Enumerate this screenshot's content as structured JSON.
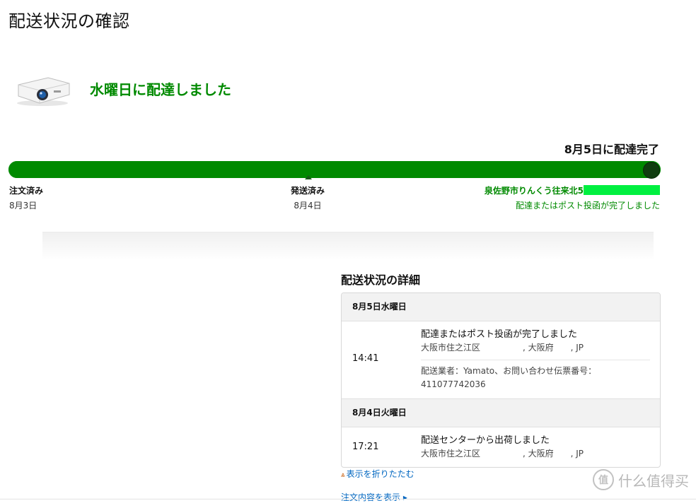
{
  "page": {
    "title": "配送状況の確認"
  },
  "delivery": {
    "headline": "水曜日に配達しました",
    "eta_label": "8月5日に配達完了",
    "progress_fraction": 1.0
  },
  "milestones": [
    {
      "label": "注文済み",
      "date": "8月3日"
    },
    {
      "label": "発送済み",
      "date": "8月4日"
    },
    {
      "label": "泉佐野市りんくう往来北5",
      "date": "配達またはポスト投函が完了しました"
    }
  ],
  "details": {
    "title": "配送状況の詳細",
    "days": [
      {
        "header": "8月5日水曜日",
        "events": [
          {
            "time": "14:41",
            "status": "配達またはポスト投函が完了しました",
            "location": "大阪市住之江区　　　　　, 大阪府　　, JP",
            "carrier": "配送業者：Yamato、お問い合わせ伝票番号：411077742036"
          }
        ]
      },
      {
        "header": "8月4日火曜日",
        "events": [
          {
            "time": "17:21",
            "status": "配送センターから出荷しました",
            "location": "大阪市住之江区　　　　　, 大阪府　　, JP"
          }
        ]
      }
    ]
  },
  "links": {
    "collapse": "表示を折りたたむ",
    "order_details": "注文内容を表示"
  },
  "watermark": {
    "badge": "值",
    "text": "什么值得买"
  },
  "colors": {
    "success_green": "#008a00",
    "progress_end": "#103d10",
    "link_blue": "#0066c0"
  }
}
